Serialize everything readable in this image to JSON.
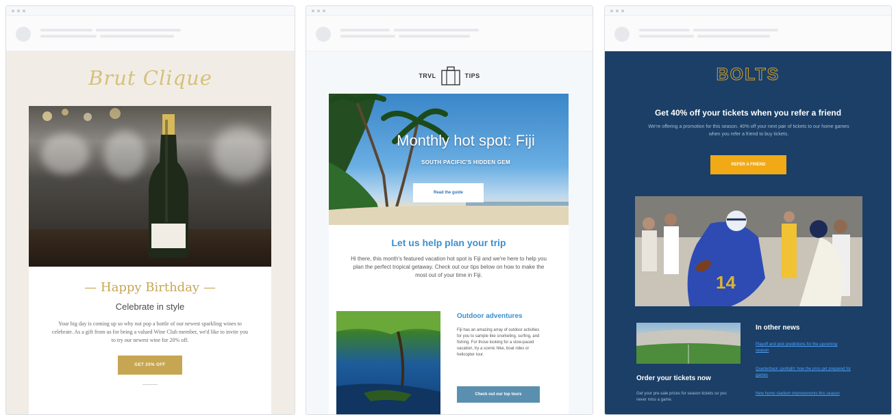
{
  "emails": {
    "birthday": {
      "logo": "Brut Clique",
      "heading": "— Happy Birthday —",
      "subheading": "Celebrate in style",
      "body": "Your big day is coming up so why not pop a bottle of our newest sparkling wines to celebrate. As a gift from us for being a valued Wine Club member, we'd like to invite you to try our newest wine for 20% off.",
      "button": "GET 20% OFF"
    },
    "travel": {
      "logo_left": "TRVL",
      "logo_right": "TIPS",
      "hero_title": "Monthly hot spot: Fiji",
      "hero_subtitle": "SOUTH PACIFIC'S HIDDEN GEM",
      "hero_button": "Read the guide",
      "section_title": "Let us help plan your trip",
      "section_body": "Hi there, this month's featured vacation hot spot is Fiji and we're here to help you plan the perfect tropical getaway. Check out our tips below on how to make the most out of your time in Fiji.",
      "feature_title": "Outdoor adventures",
      "feature_body": "Fiji has an amazing array of outdoor activities for you to sample like snorkeling, surfing, and fishing. For those looking for a slow-paced vacation, try a scenic hike, boat rides or helicopter tour.",
      "feature_button": "Check out our top tours"
    },
    "sports": {
      "logo": "BOLTS",
      "promo_title": "Get 40% off your tickets when you refer a friend",
      "promo_body": "We're offering a promotion for this season. 40% off your next pair of tickets to our home games when you refer a friend to buy tickets.",
      "promo_button": "REFER A FRIEND",
      "order_title": "Order your tickets now",
      "order_body": "Get your pre-sale prices for season tickets so you never miss a game.",
      "news_title": "In other news",
      "news_links": [
        "Playoff and pick predictions for the upcoming season",
        "Quarterback spotlight: how the pros get prepared for games",
        "New home stadium improvements this season"
      ]
    }
  },
  "colors": {
    "gold": "#c7a653",
    "travel_blue": "#3b8fcd",
    "sports_navy": "#1b3f66",
    "sports_orange": "#f2a916"
  }
}
